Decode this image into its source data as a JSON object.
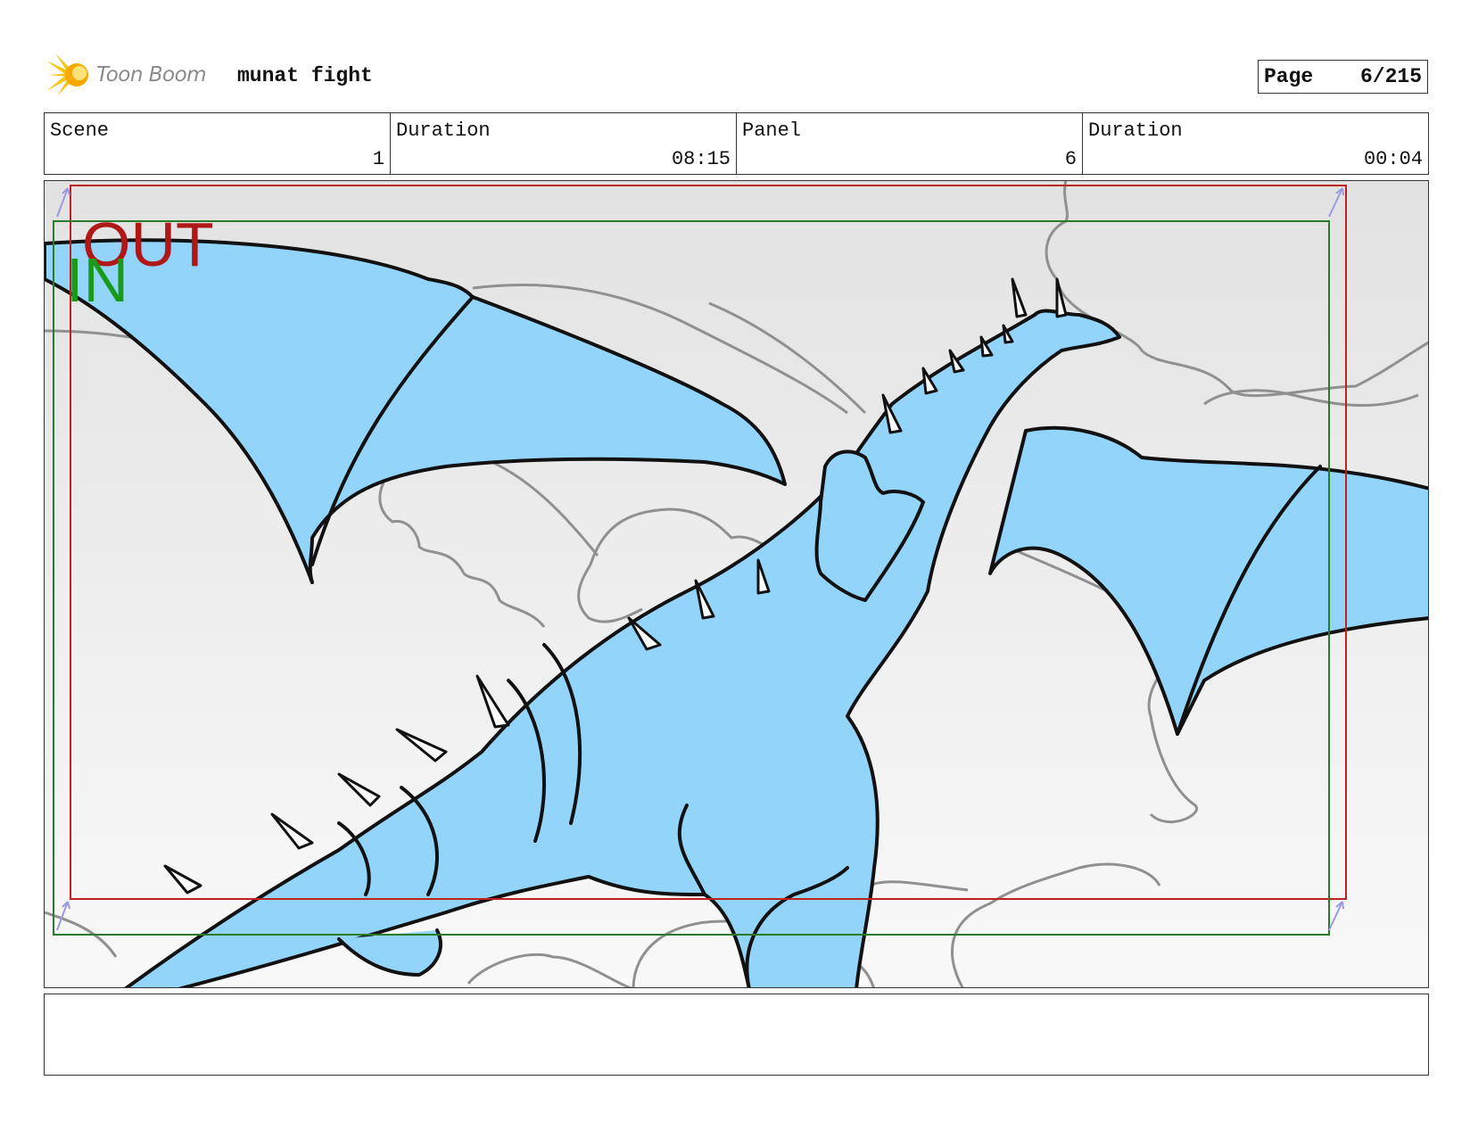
{
  "header": {
    "logo_text": "Toon Boom",
    "project_title": "munat fight",
    "page_label": "Page",
    "page_number": "6/215"
  },
  "info": {
    "scene_label": "Scene",
    "scene_value": "1",
    "scene_duration_label": "Duration",
    "scene_duration_value": "08:15",
    "panel_label": "Panel",
    "panel_value": "6",
    "panel_duration_label": "Duration",
    "panel_duration_value": "00:04"
  },
  "frame_markers": {
    "out_label": "OUT",
    "in_label": "IN",
    "out_color": "#b01818",
    "in_color": "#1a9a1a"
  },
  "colors": {
    "dragon_fill": "#93d4fb",
    "sketch_line": "#111111",
    "cloud_line": "#909090",
    "out_frame": "#c02020",
    "in_frame": "#2a7a2a"
  },
  "notes": ""
}
